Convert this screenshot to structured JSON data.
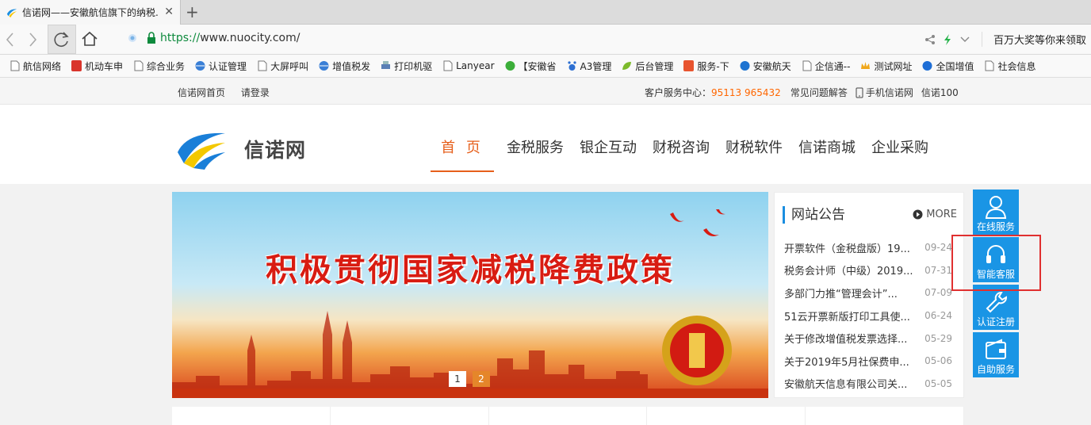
{
  "browser": {
    "tab_title": "信诺网——安徽航信旗下的纳税...",
    "close_symbol": "✕",
    "newtab_symbol": "+",
    "url_scheme": "https://",
    "url_rest": "www.nuocity.com/",
    "promo": "百万大奖等你来领取"
  },
  "bookmarks": [
    {
      "label": "航信网络",
      "icon": "page-icon"
    },
    {
      "label": "机动车申",
      "icon": "jian-icon"
    },
    {
      "label": "综合业务",
      "icon": "page-icon"
    },
    {
      "label": "认证管理",
      "icon": "globe-icon"
    },
    {
      "label": "大屏呼叫",
      "icon": "page-icon"
    },
    {
      "label": "增值税发",
      "icon": "globe-icon"
    },
    {
      "label": "打印机驱",
      "icon": "printer-icon"
    },
    {
      "label": "Lanyear",
      "icon": "page-icon"
    },
    {
      "label": "【安徽省",
      "icon": "chat-icon"
    },
    {
      "label": "A3管理",
      "icon": "paw-icon"
    },
    {
      "label": "后台管理",
      "icon": "leaf-icon"
    },
    {
      "label": "服务-下",
      "icon": "y-icon"
    },
    {
      "label": "安徽航天",
      "icon": "ie-icon"
    },
    {
      "label": "企信通--",
      "icon": "page-icon"
    },
    {
      "label": "测试网址",
      "icon": "crown-icon"
    },
    {
      "label": "全国增值",
      "icon": "q-icon"
    },
    {
      "label": "社会信息",
      "icon": "page-icon"
    }
  ],
  "topbar": {
    "home_link": "信诺网首页",
    "login_link": "请登录",
    "service_label": "客户服务中心：",
    "service_phone": "95113  965432",
    "faq": "常见问题解答",
    "mobile": "手机信诺网",
    "xinnuo100": "信诺100"
  },
  "header": {
    "logo_text": "信诺网",
    "menu": [
      "首 页",
      "金税服务",
      "银企互动",
      "财税咨询",
      "财税软件",
      "信诺商城",
      "企业采购"
    ]
  },
  "banner": {
    "slogan": "积极贯彻国家减税降费政策",
    "dots": [
      "1",
      "2"
    ]
  },
  "notice": {
    "title": "网站公告",
    "more": "MORE",
    "items": [
      {
        "title": "开票软件（金税盘版）19...",
        "date": "09-24"
      },
      {
        "title": "税务会计师（中级）2019...",
        "date": "07-31"
      },
      {
        "title": "多部门力推“管理会计”...",
        "date": "07-09"
      },
      {
        "title": "51云开票新版打印工具使...",
        "date": "06-24"
      },
      {
        "title": "关于修改增值税发票选择...",
        "date": "05-29"
      },
      {
        "title": "关于2019年5月社保费申...",
        "date": "05-06"
      },
      {
        "title": "安徽航天信息有限公司关...",
        "date": "05-05"
      }
    ]
  },
  "sidebar": [
    {
      "label": "在线服务",
      "icon": "person-icon"
    },
    {
      "label": "智能客服",
      "icon": "headset-icon"
    },
    {
      "label": "认证注册",
      "icon": "wrench-icon"
    },
    {
      "label": "自助服务",
      "icon": "wallet-icon"
    }
  ],
  "colors": {
    "accent": "#e65f1b",
    "side_blue": "#1a95e5",
    "highlight": "#e03030"
  }
}
